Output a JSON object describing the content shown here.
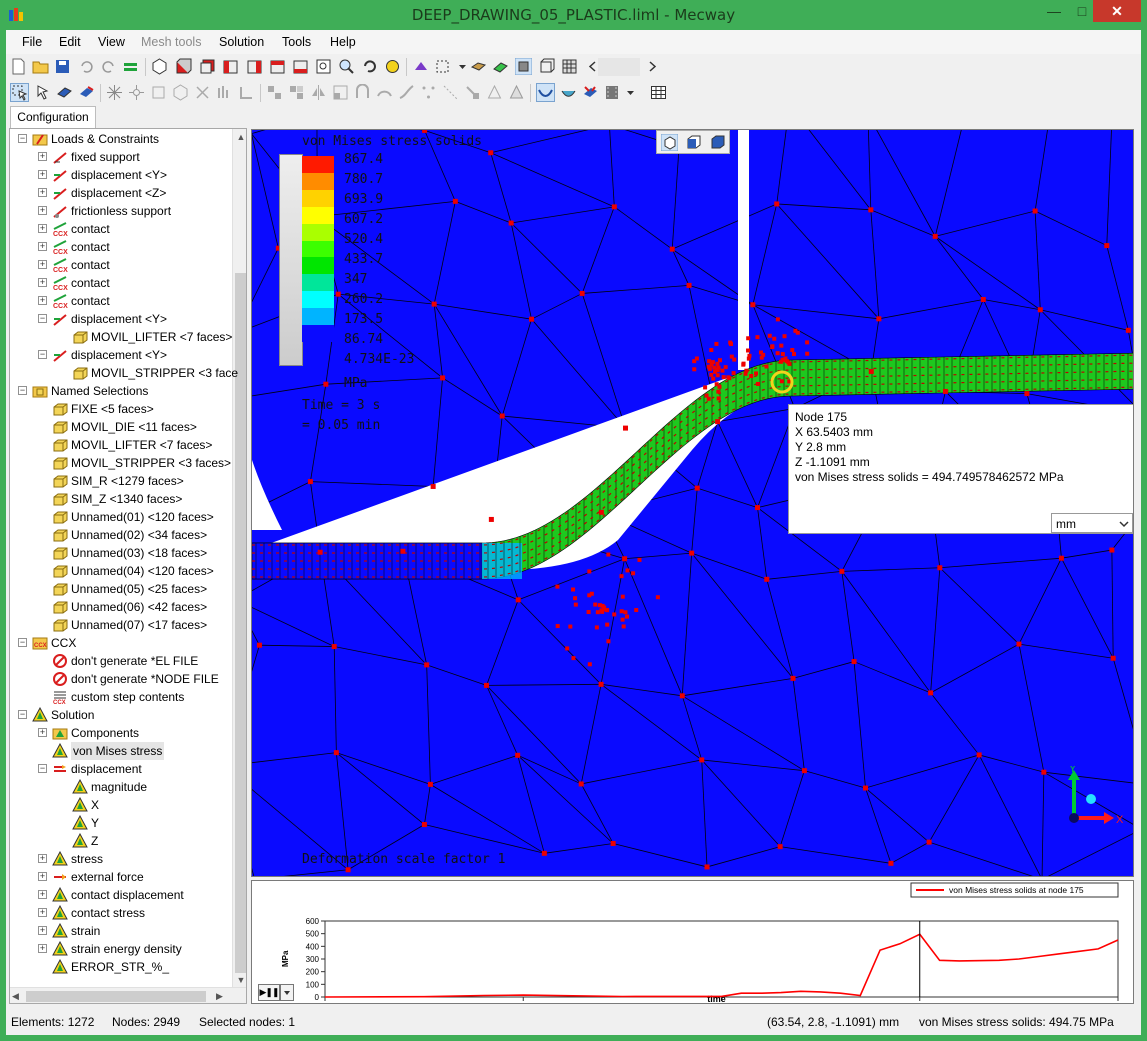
{
  "window": {
    "title": "DEEP_DRAWING_05_PLASTIC.liml - Mecway",
    "minimize": "—",
    "maximize": "□",
    "close": "✕"
  },
  "menu": [
    "File",
    "Edit",
    "View",
    "Mesh tools",
    "Solution",
    "Tools",
    "Help"
  ],
  "tabs": [
    "Configuration"
  ],
  "tree": [
    {
      "label": "Loads & Constraints",
      "level": 1,
      "expander": "−",
      "icon": "loads-folder-icon"
    },
    {
      "label": "fixed support",
      "level": 2,
      "expander": "+",
      "icon": "fixed-support-icon"
    },
    {
      "label": "displacement <Y>",
      "level": 2,
      "expander": "+",
      "icon": "displacement-icon"
    },
    {
      "label": "displacement <Z>",
      "level": 2,
      "expander": "+",
      "icon": "displacement-icon"
    },
    {
      "label": "frictionless support",
      "level": 2,
      "expander": "+",
      "icon": "frictionless-support-icon"
    },
    {
      "label": "contact",
      "level": 2,
      "expander": "+",
      "icon": "contact-icon"
    },
    {
      "label": "contact",
      "level": 2,
      "expander": "+",
      "icon": "contact-icon"
    },
    {
      "label": "contact",
      "level": 2,
      "expander": "+",
      "icon": "contact-icon"
    },
    {
      "label": "contact",
      "level": 2,
      "expander": "+",
      "icon": "contact-icon"
    },
    {
      "label": "contact",
      "level": 2,
      "expander": "+",
      "icon": "contact-icon"
    },
    {
      "label": "displacement <Y>",
      "level": 2,
      "expander": "−",
      "icon": "displacement-icon"
    },
    {
      "label": "MOVIL_LIFTER <7 faces>",
      "level": 3,
      "expander": "",
      "icon": "faces-icon"
    },
    {
      "label": "displacement <Y>",
      "level": 2,
      "expander": "−",
      "icon": "displacement-icon"
    },
    {
      "label": "MOVIL_STRIPPER <3 face",
      "level": 3,
      "expander": "",
      "icon": "faces-icon"
    },
    {
      "label": "Named Selections",
      "level": 1,
      "expander": "−",
      "icon": "named-selections-icon"
    },
    {
      "label": "FIXE <5 faces>",
      "level": 2,
      "expander": "",
      "icon": "faces-icon"
    },
    {
      "label": "MOVIL_DIE <11 faces>",
      "level": 2,
      "expander": "",
      "icon": "faces-icon"
    },
    {
      "label": "MOVIL_LIFTER <7 faces>",
      "level": 2,
      "expander": "",
      "icon": "faces-icon"
    },
    {
      "label": "MOVIL_STRIPPER <3 faces>",
      "level": 2,
      "expander": "",
      "icon": "faces-icon"
    },
    {
      "label": "SIM_R <1279 faces>",
      "level": 2,
      "expander": "",
      "icon": "faces-icon"
    },
    {
      "label": "SIM_Z <1340 faces>",
      "level": 2,
      "expander": "",
      "icon": "faces-icon"
    },
    {
      "label": "Unnamed(01) <120 faces>",
      "level": 2,
      "expander": "",
      "icon": "faces-icon"
    },
    {
      "label": "Unnamed(02) <34 faces>",
      "level": 2,
      "expander": "",
      "icon": "faces-icon"
    },
    {
      "label": "Unnamed(03) <18 faces>",
      "level": 2,
      "expander": "",
      "icon": "faces-icon"
    },
    {
      "label": "Unnamed(04) <120 faces>",
      "level": 2,
      "expander": "",
      "icon": "faces-icon"
    },
    {
      "label": "Unnamed(05) <25 faces>",
      "level": 2,
      "expander": "",
      "icon": "faces-icon"
    },
    {
      "label": "Unnamed(06) <42 faces>",
      "level": 2,
      "expander": "",
      "icon": "faces-icon"
    },
    {
      "label": "Unnamed(07) <17 faces>",
      "level": 2,
      "expander": "",
      "icon": "faces-icon"
    },
    {
      "label": "CCX",
      "level": 1,
      "expander": "−",
      "icon": "ccx-icon"
    },
    {
      "label": "don't generate *EL FILE",
      "level": 2,
      "expander": "",
      "icon": "ccx-disabled-icon"
    },
    {
      "label": "don't generate *NODE FILE",
      "level": 2,
      "expander": "",
      "icon": "ccx-disabled-icon"
    },
    {
      "label": "custom step contents",
      "level": 2,
      "expander": "",
      "icon": "ccx-custom-icon"
    },
    {
      "label": "Solution",
      "level": 1,
      "expander": "−",
      "icon": "solution-icon"
    },
    {
      "label": "Components",
      "level": 2,
      "expander": "+",
      "icon": "components-icon"
    },
    {
      "label": "von Mises stress",
      "level": 2,
      "expander": "",
      "icon": "solution-icon",
      "selected": true
    },
    {
      "label": "displacement",
      "level": 2,
      "expander": "−",
      "icon": "displacement-result-icon"
    },
    {
      "label": "magnitude",
      "level": 3,
      "expander": "",
      "icon": "solution-icon"
    },
    {
      "label": "X",
      "level": 3,
      "expander": "",
      "icon": "solution-icon"
    },
    {
      "label": "Y",
      "level": 3,
      "expander": "",
      "icon": "solution-icon"
    },
    {
      "label": "Z",
      "level": 3,
      "expander": "",
      "icon": "solution-icon"
    },
    {
      "label": "stress",
      "level": 2,
      "expander": "+",
      "icon": "solution-icon"
    },
    {
      "label": "external force",
      "level": 2,
      "expander": "+",
      "icon": "force-result-icon"
    },
    {
      "label": "contact displacement",
      "level": 2,
      "expander": "+",
      "icon": "solution-icon"
    },
    {
      "label": "contact stress",
      "level": 2,
      "expander": "+",
      "icon": "solution-icon"
    },
    {
      "label": "strain",
      "level": 2,
      "expander": "+",
      "icon": "solution-icon"
    },
    {
      "label": "strain energy density",
      "level": 2,
      "expander": "+",
      "icon": "solution-icon"
    },
    {
      "label": "ERROR_STR_%_",
      "level": 2,
      "expander": "",
      "icon": "solution-icon"
    }
  ],
  "view": {
    "result_title": "von Mises stress solids",
    "legend_values": [
      "867.4",
      "780.7",
      "693.9",
      "607.2",
      "520.4",
      "433.7",
      "347",
      "260.2",
      "173.5",
      "86.74",
      "4.734E-23"
    ],
    "legend_colors": [
      "#ff1a00",
      "#ff8c00",
      "#ffd200",
      "#ffff00",
      "#aaff00",
      "#3cff00",
      "#00e600",
      "#00e69a",
      "#00ffff",
      "#00b4ff",
      "#0a0aff"
    ],
    "unit": "MPa",
    "time": "Time = 3 s",
    "time_min": "= 0.05 min",
    "scale_factor": "Deformation scale factor 1",
    "axis_x": "X",
    "axis_y": "Y"
  },
  "tooltip": {
    "node": "Node  175",
    "x": "X  63.5403 mm",
    "y": "Y  2.8 mm",
    "z": "Z  -1.1091 mm",
    "value": "von Mises stress solids = 494.749578462572 MPa",
    "unit_select": "mm"
  },
  "chart_data": {
    "type": "line",
    "title": "",
    "xlabel": "time",
    "ylabel": "MPa",
    "xlim": [
      0,
      4
    ],
    "ylim": [
      0,
      600
    ],
    "x_ticks": [
      "0",
      "1",
      "2",
      "3",
      "4"
    ],
    "y_ticks": [
      "0",
      "100",
      "200",
      "300",
      "400",
      "500",
      "600"
    ],
    "legend_position": "top-right",
    "cursor_x": 3,
    "series": [
      {
        "name": "von Mises stress solids at node 175",
        "color": "#ff0000",
        "x": [
          0,
          0.5,
          0.8,
          1.0,
          1.5,
          2.0,
          2.1,
          2.2,
          2.3,
          2.4,
          2.5,
          2.6,
          2.7,
          2.8,
          2.9,
          3.0,
          3.1,
          3.2,
          3.4,
          3.5,
          3.6,
          3.7,
          3.8,
          3.9,
          4.0
        ],
        "values": [
          0,
          2,
          12,
          15,
          4,
          5,
          30,
          30,
          35,
          45,
          40,
          30,
          12,
          370,
          420,
          495,
          290,
          285,
          290,
          300,
          320,
          340,
          360,
          380,
          450
        ]
      }
    ]
  },
  "play_button": "▶❚❚",
  "status": {
    "elements": "Elements: 1272",
    "nodes": "Nodes: 2949",
    "selected": "Selected nodes: 1",
    "coords": "(63.54, 2.8, -1.1091) mm",
    "value": "von Mises stress solids: 494.75 MPa"
  }
}
